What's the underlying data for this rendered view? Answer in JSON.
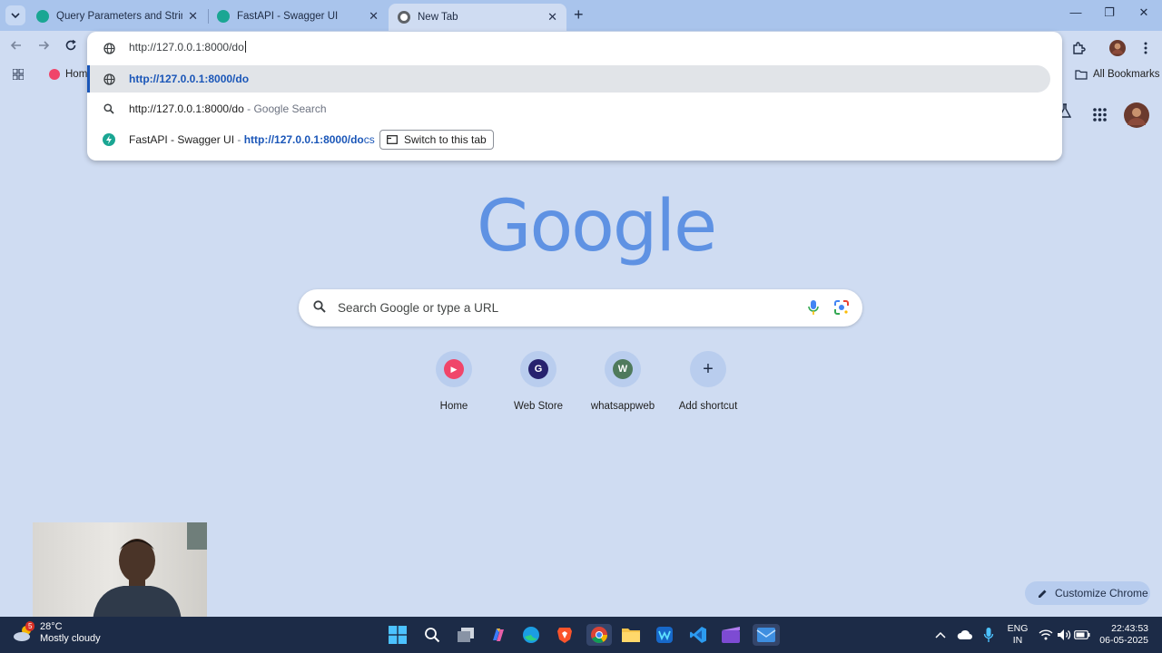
{
  "browser": {
    "tabs": [
      {
        "label": "Query Parameters and String Va",
        "favicon_color": "#1aa693"
      },
      {
        "label": "FastAPI - Swagger UI",
        "favicon_color": "#1aa693"
      },
      {
        "label": "New Tab",
        "favicon_color": "#5f6368"
      }
    ],
    "close_glyph": "✕",
    "new_tab_glyph": "+",
    "window_controls": {
      "minimize": "—",
      "maximize": "❐",
      "close": "✕"
    }
  },
  "bookmarks_bar": {
    "home_label": "Home",
    "all_bookmarks_label": "All Bookmarks"
  },
  "omnibox": {
    "input_value": "http://127.0.0.1:8000/do",
    "suggestions": [
      {
        "url": "http://127.0.0.1:8000/do",
        "icon": "globe-icon"
      },
      {
        "query": "http://127.0.0.1:8000/do",
        "suffix": " - Google Search",
        "icon": "search-icon"
      },
      {
        "title": "FastAPI - Swagger UI",
        "separator": " - ",
        "url_typed": "http://127.0.0.1:8000/do",
        "url_rest": "cs",
        "switch_label": "Switch to this tab",
        "icon": "fastapi-icon"
      }
    ]
  },
  "ntp": {
    "logo": "Google",
    "search_placeholder": "Search Google or type a URL",
    "shortcuts": [
      {
        "label": "Home",
        "letter": "",
        "color": "#f0456a"
      },
      {
        "label": "Web Store",
        "letter": "G",
        "color": "#27226e"
      },
      {
        "label": "whatsappweb",
        "letter": "W",
        "color": "#4f7a5c"
      },
      {
        "label": "Add shortcut",
        "letter": "+",
        "color": "#b9cdee"
      }
    ],
    "customize_label": "Customize Chrome"
  },
  "taskbar": {
    "weather_temp": "28°C",
    "weather_desc": "Mostly cloudy",
    "weather_badge": "5",
    "lang_1": "ENG",
    "lang_2": "IN",
    "time": "22:43:53",
    "date": "06-05-2025"
  }
}
